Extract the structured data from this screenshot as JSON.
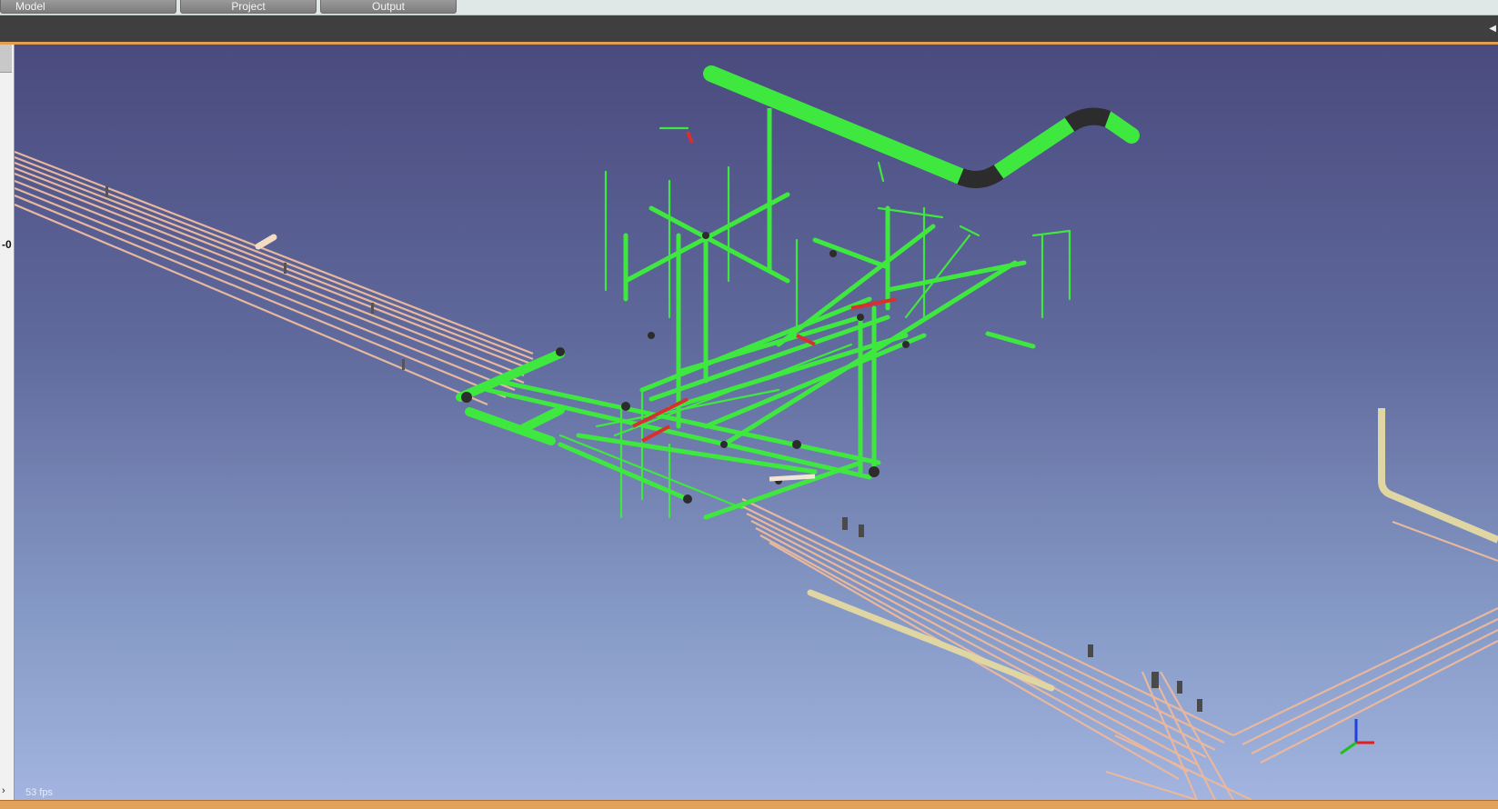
{
  "tabs": [
    {
      "label": "Model"
    },
    {
      "label": "Project"
    },
    {
      "label": "Output"
    }
  ],
  "toolbar": {
    "collapse_icon": "triangle-left-icon"
  },
  "left_panel": {
    "value_label": "-0",
    "arrow_icon": "chevron-right-icon"
  },
  "viewport": {
    "fps_label": "53 fps",
    "background_top": "#4a4a7e",
    "background_bottom": "#a2b4df",
    "pipe_colors": {
      "selected": "#3fe83f",
      "unselected": "#e8b89e",
      "highlight": "#e0d6a4",
      "fitting": "#2c2c2c",
      "alert": "#d83030"
    }
  },
  "axis_triad": {
    "x_color": "#e02020",
    "y_color": "#20c020",
    "z_color": "#2040e0"
  }
}
